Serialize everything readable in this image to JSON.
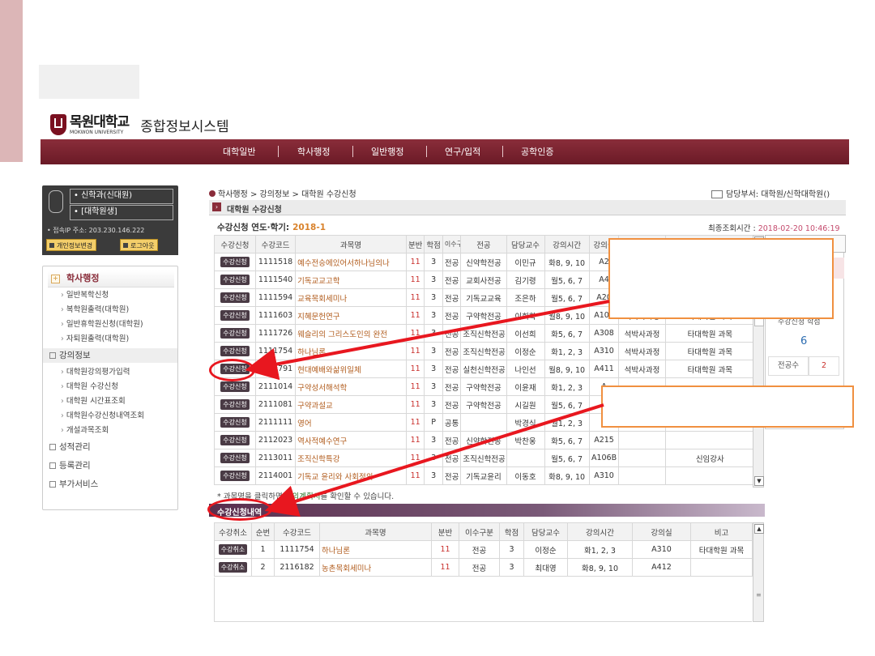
{
  "header": {
    "logo_text": "목원대학교",
    "logo_sub": "MOKWON UNIVERSITY",
    "system_title": "종합정보시스템",
    "nav": [
      "대학일반",
      "학사행정",
      "일반행정",
      "연구/입적",
      "공학인증"
    ]
  },
  "user": {
    "dept": "• 신학과(신대원)",
    "status": "• [대학원생]",
    "ip": "• 접속IP 주소: 203.230.146.222",
    "btn_info": "개인정보변경",
    "btn_logout": "로그아웃"
  },
  "leftmenu": {
    "head": "학사행정",
    "group1_items": [
      "일반복학신청",
      "복학원출력(대학원)",
      "일반휴학원신청(대학원)",
      "자퇴원출력(대학원)"
    ],
    "group2": "강의정보",
    "group2_items": [
      "대학원강의평가입력",
      "대학원 수강신청",
      "대학원 시간표조회",
      "대학원수강신청내역조회",
      "개설과목조회"
    ],
    "group3": "성적관리",
    "group4": "등록관리",
    "group5": "부가서비스"
  },
  "main": {
    "breadcrumb": "학사행정 > 강의정보 > 대학원 수강신청",
    "dept_label": "담당부서: 대학원/신학대학원()",
    "section_title": "대학원 수강신청",
    "year_label": "수강신청 연도·학기:",
    "year_value": "2018-1",
    "last_query_label": "최종조회시간 :",
    "last_query_value": "2018-02-20 10:46:19",
    "table_headers": [
      "수강신청",
      "수강코드",
      "과목명",
      "분반",
      "학점",
      "이수구분",
      "전공",
      "담당교수",
      "강의시간",
      "강의실",
      "",
      ""
    ],
    "req_btn": "수강신청",
    "rows": [
      {
        "code": "1111518",
        "name": "예수전승에있어서하나님의나",
        "cls": "11",
        "cr": "3",
        "type": "전공",
        "major": "신약학전공",
        "prof": "이민규",
        "time": "화8, 9, 10",
        "room": "A2",
        "c1": "",
        "c2": ""
      },
      {
        "code": "1111540",
        "name": "기독교교고학",
        "cls": "11",
        "cr": "3",
        "type": "전공",
        "major": "교회사전공",
        "prof": "김기령",
        "time": "월5, 6, 7",
        "room": "A4",
        "c1": "",
        "c2": ""
      },
      {
        "code": "1111594",
        "name": "교육목회세미나",
        "cls": "11",
        "cr": "3",
        "type": "전공",
        "major": "기독교교육",
        "prof": "조은하",
        "time": "월5, 6, 7",
        "room": "A20",
        "c1": "",
        "c2": ""
      },
      {
        "code": "1111603",
        "name": "지혜문헌연구",
        "cls": "11",
        "cr": "3",
        "type": "전공",
        "major": "구약학전공",
        "prof": "이희학",
        "time": "월8, 9, 10",
        "room": "A103",
        "c1": "석박사과정",
        "c2": "타대학원 과목"
      },
      {
        "code": "1111726",
        "name": "웨슬리의 그리스도인의 완전",
        "cls": "11",
        "cr": "3",
        "type": "전공",
        "major": "조직신학전공",
        "prof": "이선희",
        "time": "화5, 6, 7",
        "room": "A308",
        "c1": "석박사과정",
        "c2": "타대학원 과목"
      },
      {
        "code": "1111754",
        "name": "하나님론",
        "cls": "11",
        "cr": "3",
        "type": "전공",
        "major": "조직신학전공",
        "prof": "이정순",
        "time": "화1, 2, 3",
        "room": "A310",
        "c1": "석박사과정",
        "c2": "타대학원 과목"
      },
      {
        "code": "1111791",
        "name": "현대예배와삶위일체",
        "cls": "11",
        "cr": "3",
        "type": "전공",
        "major": "실천신학전공",
        "prof": "나인선",
        "time": "월8, 9, 10",
        "room": "A411",
        "c1": "석박사과정",
        "c2": "타대학원 과목"
      },
      {
        "code": "2111014",
        "name": "구약성서해석학",
        "cls": "11",
        "cr": "3",
        "type": "전공",
        "major": "구약학전공",
        "prof": "이윤재",
        "time": "화1, 2, 3",
        "room": "A",
        "c1": "",
        "c2": ""
      },
      {
        "code": "2111081",
        "name": "구약과설교",
        "cls": "11",
        "cr": "3",
        "type": "전공",
        "major": "구약학전공",
        "prof": "시길원",
        "time": "월5, 6, 7",
        "room": "A",
        "c1": "",
        "c2": ""
      },
      {
        "code": "2111111",
        "name": "영어",
        "cls": "11",
        "cr": "P",
        "type": "공통",
        "major": "",
        "prof": "박경식",
        "time": "월1, 2, 3",
        "room": "A",
        "c1": "",
        "c2": ""
      },
      {
        "code": "2112023",
        "name": "역사적예수연구",
        "cls": "11",
        "cr": "3",
        "type": "전공",
        "major": "신약학전공",
        "prof": "박찬웅",
        "time": "화5, 6, 7",
        "room": "A215",
        "c1": "",
        "c2": ""
      },
      {
        "code": "2113011",
        "name": "조직신학특강",
        "cls": "11",
        "cr": "3",
        "type": "전공",
        "major": "조직신학전공",
        "prof": "",
        "time": "월5, 6, 7",
        "room": "A106B",
        "c1": "",
        "c2": "신임강사"
      },
      {
        "code": "2114001",
        "name": "기독교 윤리와 사회정의",
        "cls": "11",
        "cr": "3",
        "type": "전공",
        "major": "기독교윤리",
        "prof": "이동호",
        "time": "화8, 9, 10",
        "room": "A310",
        "c1": "",
        "c2": ""
      }
    ],
    "note_prefix": "* 과목명을 클릭하면 ",
    "note_link": "강의계획서",
    "note_suffix": "를 확인할 수 있습니다.",
    "section2_title": "수강신청내역",
    "table2_headers": [
      "수강취소",
      "순번",
      "수강코드",
      "과목명",
      "분반",
      "이수구분",
      "학점",
      "담당교수",
      "강의시간",
      "강의실",
      "비고"
    ],
    "cancel_btn": "수강취소",
    "rows2": [
      {
        "no": "1",
        "code": "1111754",
        "name": "하나님론",
        "cls": "11",
        "type": "전공",
        "cr": "3",
        "prof": "이정순",
        "time": "화1, 2, 3",
        "room": "A310",
        "note": "타대학원 과목"
      },
      {
        "no": "2",
        "code": "2116182",
        "name": "농촌목회세미나",
        "cls": "11",
        "type": "전공",
        "cr": "3",
        "prof": "최대영",
        "time": "화8, 9, 10",
        "room": "A412",
        "note": ""
      }
    ]
  },
  "right": {
    "label": "수강신청 학점",
    "number": "6",
    "major_label": "전공수",
    "major_value": "2"
  },
  "colors": {
    "brand": "#8a2d3a",
    "accent_orange": "#d9822b",
    "callout_red": "#e8171f"
  }
}
